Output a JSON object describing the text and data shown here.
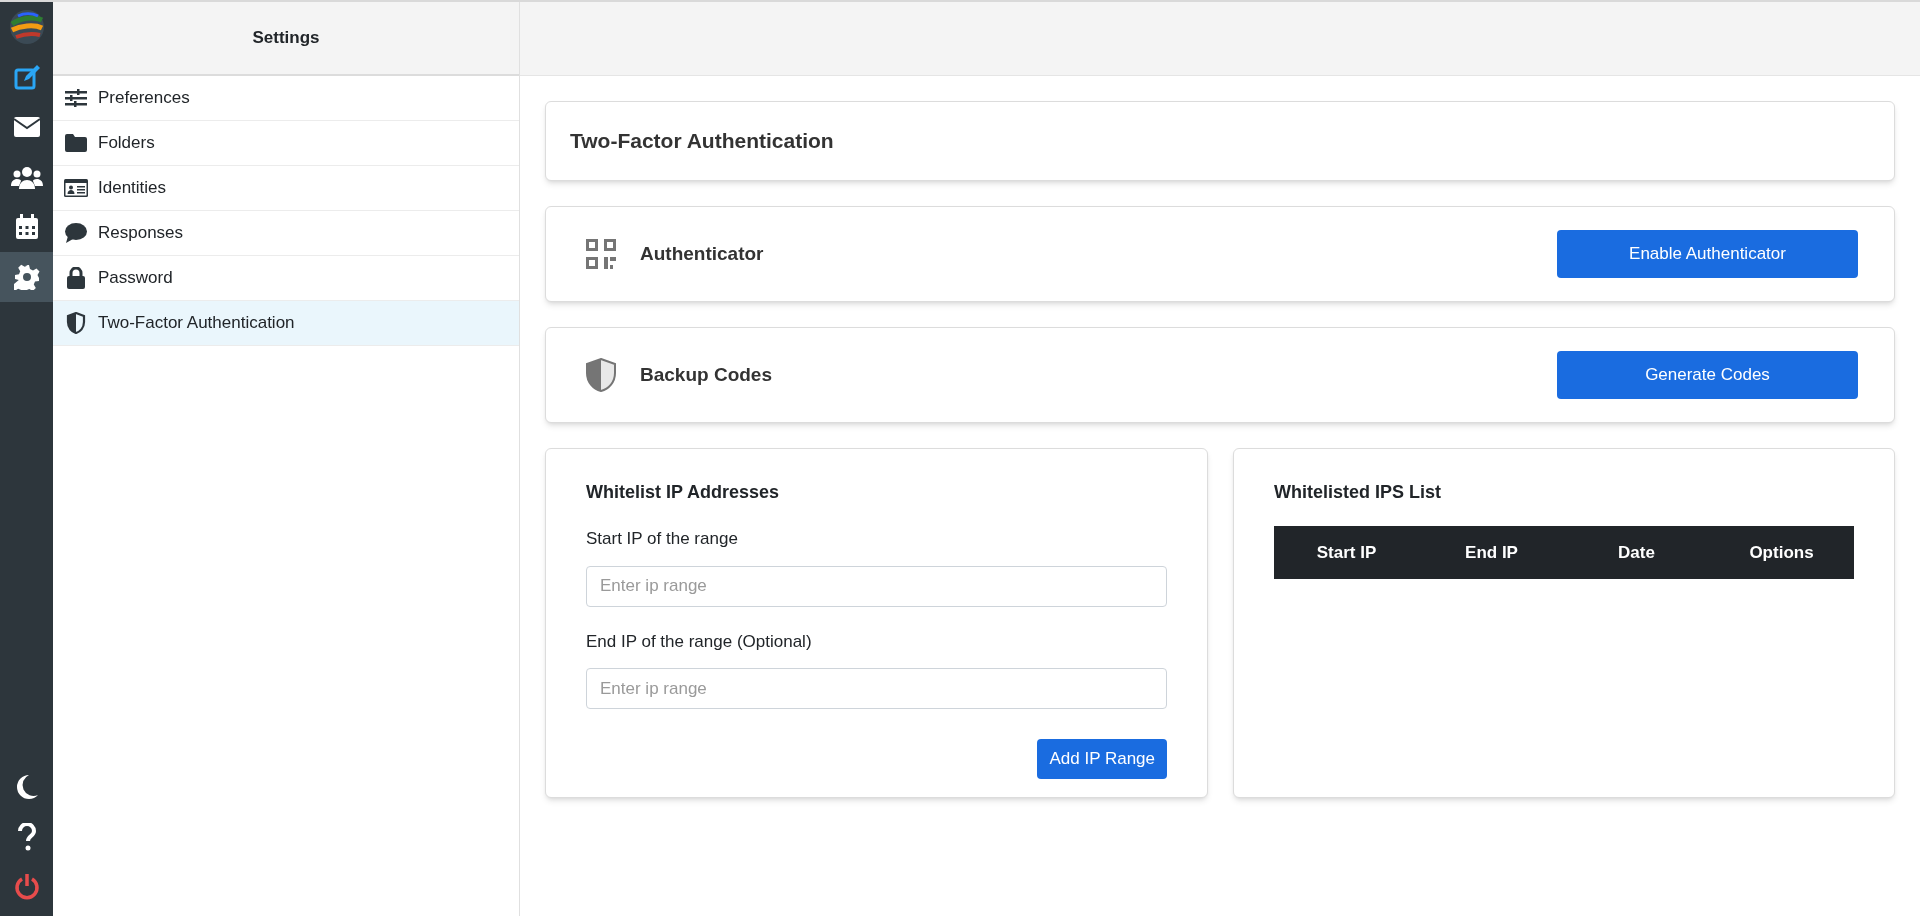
{
  "rail": {
    "items": [
      {
        "kind": "compose",
        "selected": false
      },
      {
        "kind": "mail",
        "selected": false
      },
      {
        "kind": "contacts",
        "selected": false
      },
      {
        "kind": "calendar",
        "selected": false
      },
      {
        "kind": "settings",
        "selected": true
      }
    ],
    "bottom": [
      {
        "kind": "moon"
      },
      {
        "kind": "help"
      },
      {
        "kind": "power"
      }
    ]
  },
  "sidebar": {
    "title": "Settings",
    "items": [
      {
        "kind": "sliders",
        "label": "Preferences",
        "selected": false
      },
      {
        "kind": "folder",
        "label": "Folders",
        "selected": false
      },
      {
        "kind": "idcard",
        "label": "Identities",
        "selected": false
      },
      {
        "kind": "comment",
        "label": "Responses",
        "selected": false
      },
      {
        "kind": "lock",
        "label": "Password",
        "selected": false
      },
      {
        "kind": "shield",
        "label": "Two-Factor Authentication",
        "selected": true
      }
    ]
  },
  "page_title": "Two-Factor Authentication",
  "methods": [
    {
      "kind": "qr",
      "label": "Authenticator",
      "button": "Enable Authenticator"
    },
    {
      "kind": "shield",
      "label": "Backup Codes",
      "button": "Generate Codes"
    }
  ],
  "whitelist_form": {
    "title": "Whitelist IP Addresses",
    "fields": [
      {
        "label": "Start IP of the range",
        "placeholder": "Enter ip range"
      },
      {
        "label": "End IP of the range (Optional)",
        "placeholder": "Enter ip range"
      }
    ],
    "button": "Add IP Range"
  },
  "whitelist_table": {
    "title": "Whitelisted IPS List",
    "columns": [
      "Start IP",
      "End IP",
      "Date",
      "Options"
    ]
  }
}
